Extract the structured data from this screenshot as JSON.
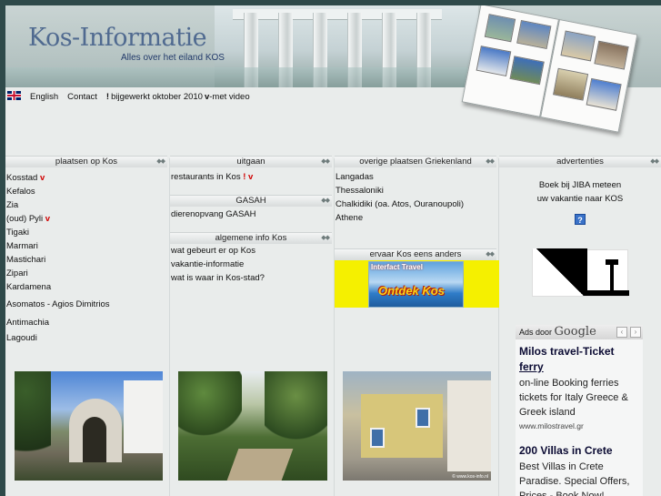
{
  "header": {
    "title": "Kos-Informatie",
    "subtitle": "Alles over het eiland KOS"
  },
  "nav": {
    "english": "English",
    "contact": "Contact",
    "update_mark": "!",
    "update_text": "bijgewerkt oktober 2010",
    "video_mark": "v",
    "video_text": "-met video"
  },
  "col1": {
    "heading": "plaatsen op Kos",
    "items": [
      "Kosstad",
      "Kefalos",
      "Zia",
      "(oud) Pyli",
      "Tigaki",
      "Marmari",
      "Mastichari",
      "Zipari",
      "Kardamena",
      "Asomatos - Agios Dimitrios",
      "Antimachia",
      "Lagoudi"
    ],
    "markers": {
      "kosstad": "v",
      "pyli": "v"
    }
  },
  "col2": {
    "heading1": "uitgaan",
    "item1": "restaurants in Kos",
    "item1_mark1": "!",
    "item1_mark2": "v",
    "heading2": "GASAH",
    "item2": "dierenopvang GASAH",
    "heading3": "algemene info Kos",
    "items3": [
      "wat gebeurt er op Kos",
      "vakantie-informatie",
      "wat is waar in Kos-stad?"
    ]
  },
  "col3": {
    "heading1": "overige plaatsen Griekenland",
    "items": [
      "Langadas",
      "Thessaloniki",
      "Chalkidiki (oa. Atos, Ouranoupoli)",
      "Athene"
    ],
    "heading2": "ervaar Kos eens anders",
    "banner_top": "Interfact Travel",
    "banner_main": "Ontdek Kos"
  },
  "col4": {
    "heading": "advertenties",
    "ad_line1": "Boek bij JIBA meteen",
    "ad_line2": "uw vakantie naar KOS",
    "help_label": "?"
  },
  "google_ads": {
    "label": "Ads door",
    "brand": "Google",
    "prev": "‹",
    "next": "›",
    "ads": [
      {
        "title1": "Milos travel-Ticket",
        "title2": "ferry",
        "text": "on-line Booking ferries tickets for Italy Greece & Greek island",
        "url": "www.milostravel.gr"
      },
      {
        "title1": "200 Villas in Crete",
        "text": "Best Villas in Crete Paradise. Special Offers, Prices - Book Now!"
      }
    ]
  },
  "photo_caption": "© www.kos-info.nl",
  "colors": {
    "accent_red": "#d00000",
    "title_blue": "#506a90",
    "subtitle_blue": "#223a6a"
  }
}
